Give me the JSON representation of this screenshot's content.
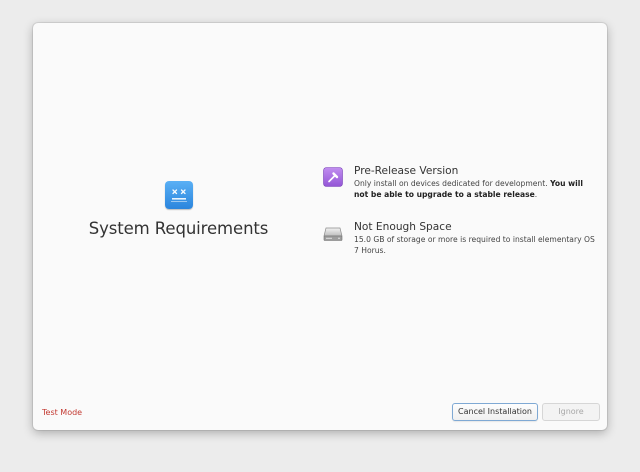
{
  "main": {
    "title": "System Requirements",
    "icon": "dialog-error-icon"
  },
  "requirements": [
    {
      "icon": "hammer-icon",
      "title": "Pre-Release Version",
      "description": "Only install on devices dedicated for development. ",
      "description_bold": "You will not be able to upgrade to a stable release",
      "description_tail": "."
    },
    {
      "icon": "drive-harddisk-icon",
      "title": "Not Enough Space",
      "description": "15.0 GB of storage or more is required to install elementary OS 7 Horus."
    }
  ],
  "footer": {
    "test_mode_label": "Test Mode",
    "cancel_label": "Cancel Installation",
    "ignore_label": "Ignore"
  },
  "colors": {
    "test_mode": "#c33a32",
    "accent_blue": "#3d8fe0",
    "pre_release_purple": "#a56de2"
  }
}
